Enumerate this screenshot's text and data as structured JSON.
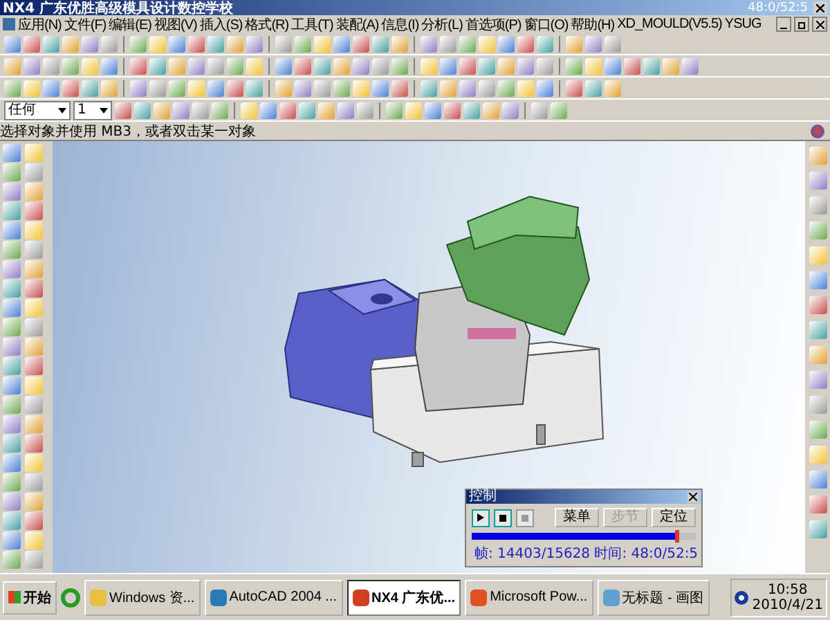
{
  "window": {
    "title": "NX4 广东优胜高级模具设计数控学校",
    "timer": "48:0/52:5"
  },
  "menu": [
    "应用(N)",
    "文件(F)",
    "编辑(E)",
    "视图(V)",
    "插入(S)",
    "格式(R)",
    "工具(T)",
    "装配(A)",
    "信息(I)",
    "分析(L)",
    "首选项(P)",
    "窗口(O)",
    "帮助(H)",
    "XD_MOULD(V5.5)",
    "YSUG"
  ],
  "toolbar": {
    "selection_filter": "任何",
    "layer": "1"
  },
  "status_line": "选择对象并使用 MB3，或者双击某一对象",
  "control_panel": {
    "title": "控制",
    "buttons": [
      {
        "label": "菜单",
        "disabled": false
      },
      {
        "label": "步节",
        "disabled": true
      },
      {
        "label": "定位",
        "disabled": false
      }
    ],
    "level": 0.92,
    "frame_info": "帧: 14403/15628 时间: 48:0/52:5"
  },
  "taskbar": {
    "start": "开始",
    "tasks": [
      {
        "kind": "folder",
        "label": "Windows 资...",
        "selected": false
      },
      {
        "kind": "autocad",
        "label": "AutoCAD 2004 ...",
        "selected": false
      },
      {
        "kind": "nx",
        "label": "NX4 广东优...",
        "selected": true
      },
      {
        "kind": "powerpoint",
        "label": "Microsoft Pow...",
        "selected": false
      },
      {
        "kind": "paint",
        "label": "无标题 - 画图",
        "selected": false
      }
    ],
    "clock": "10:58",
    "date": "2010/4/21"
  }
}
